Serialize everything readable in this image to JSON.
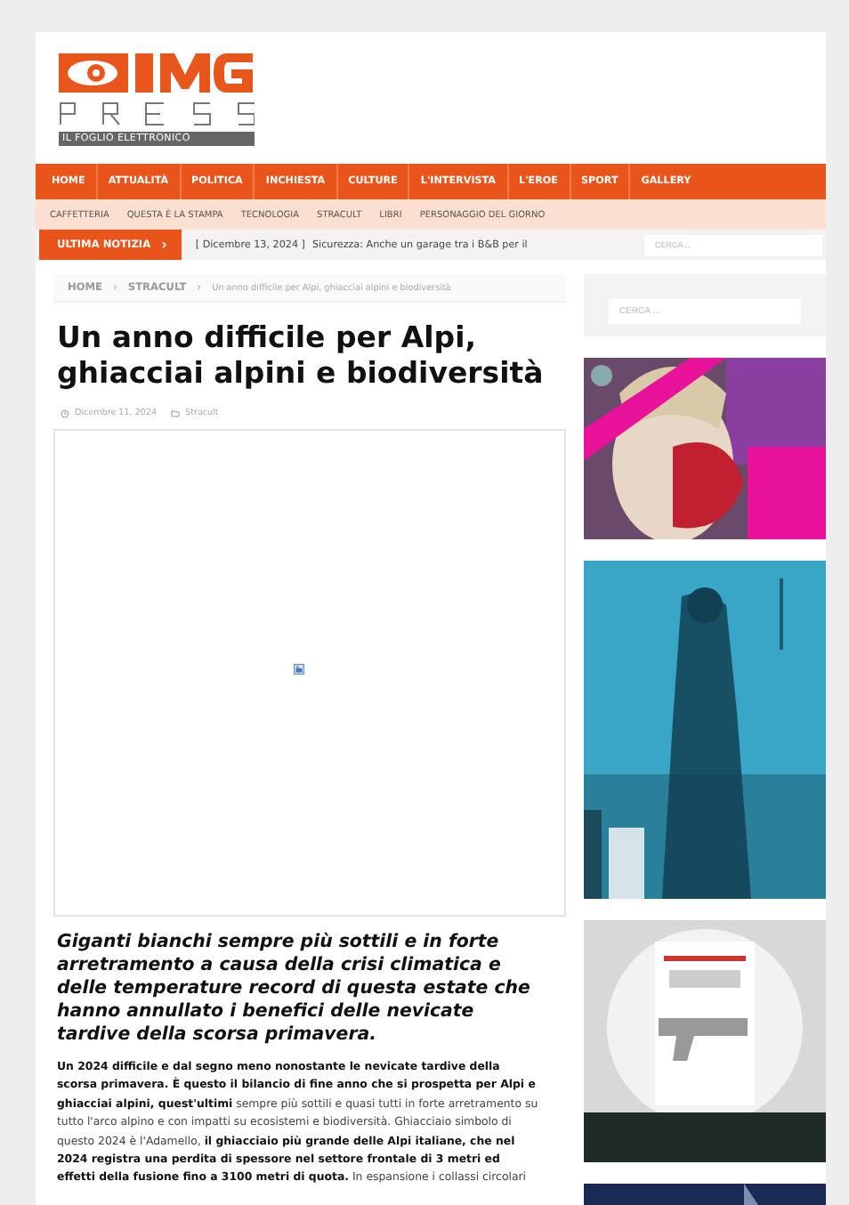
{
  "logo": {
    "subtitle": "IL FOGLIO ELETTRONICO"
  },
  "main_nav": [
    {
      "label": "HOME"
    },
    {
      "label": "ATTUALITÀ"
    },
    {
      "label": "POLITICA"
    },
    {
      "label": "INCHIESTA"
    },
    {
      "label": "CULTURE"
    },
    {
      "label": "L'INTERVISTA"
    },
    {
      "label": "L'EROE"
    },
    {
      "label": "SPORT"
    },
    {
      "label": "GALLERY"
    }
  ],
  "sub_nav": [
    {
      "label": "CAFFETTERIA"
    },
    {
      "label": "QUESTA È LA STAMPA"
    },
    {
      "label": "TECNOLOGIA"
    },
    {
      "label": "STRACULT"
    },
    {
      "label": "LIBRI"
    },
    {
      "label": "PERSONAGGIO DEL GIORNO"
    }
  ],
  "ticker": {
    "label": "ULTIMA NOTIZIA",
    "arrow": "›",
    "date": "[ Dicembre 13, 2024 ]",
    "headline": "Sicurezza: Anche un garage tra i B&B per il"
  },
  "header_search": {
    "placeholder": "CERCA ..."
  },
  "breadcrumb": [
    {
      "label": "HOME"
    },
    {
      "label": "STRACULT"
    },
    {
      "label": "Un anno difficile per Alpi, ghiacciai alpini e biodiversità"
    }
  ],
  "breadcrumb_separator": "›",
  "article": {
    "title": "Un anno difficile per Alpi, ghiacciai alpini e biodiversità",
    "date": "Dicembre 11, 2024",
    "category": "Stracult",
    "lead": "Giganti bianchi sempre più sottili e in forte arretramento a causa della crisi climatica e delle temperature record di questa estate che hanno annullato i benefici delle nevicate tardive della scorsa primavera.",
    "body": "**Un 2024 difficile e dal segno meno nonostante le nevicate tardive della scorsa primavera. È questo il bilancio di fine anno che si prospetta per Alpi e ghiacciai alpini, quest'ultimi** sempre più sottili e quasi tutti in forte arretramento su tutto l'arco alpino e con impatti su ecosistemi e biodiversità. Ghiacciaio simbolo di questo 2024 è l'Adamello, **il ghiacciaio più grande delle Alpi italiane, che nel 2024 registra una perdita di spessore nel settore frontale di 3 metri ed effetti della fusione fino a 3100 metri di quota.** In espansione i collassi circolari"
  },
  "sidebar": {
    "search": {
      "placeholder": "CERCA ..."
    }
  }
}
